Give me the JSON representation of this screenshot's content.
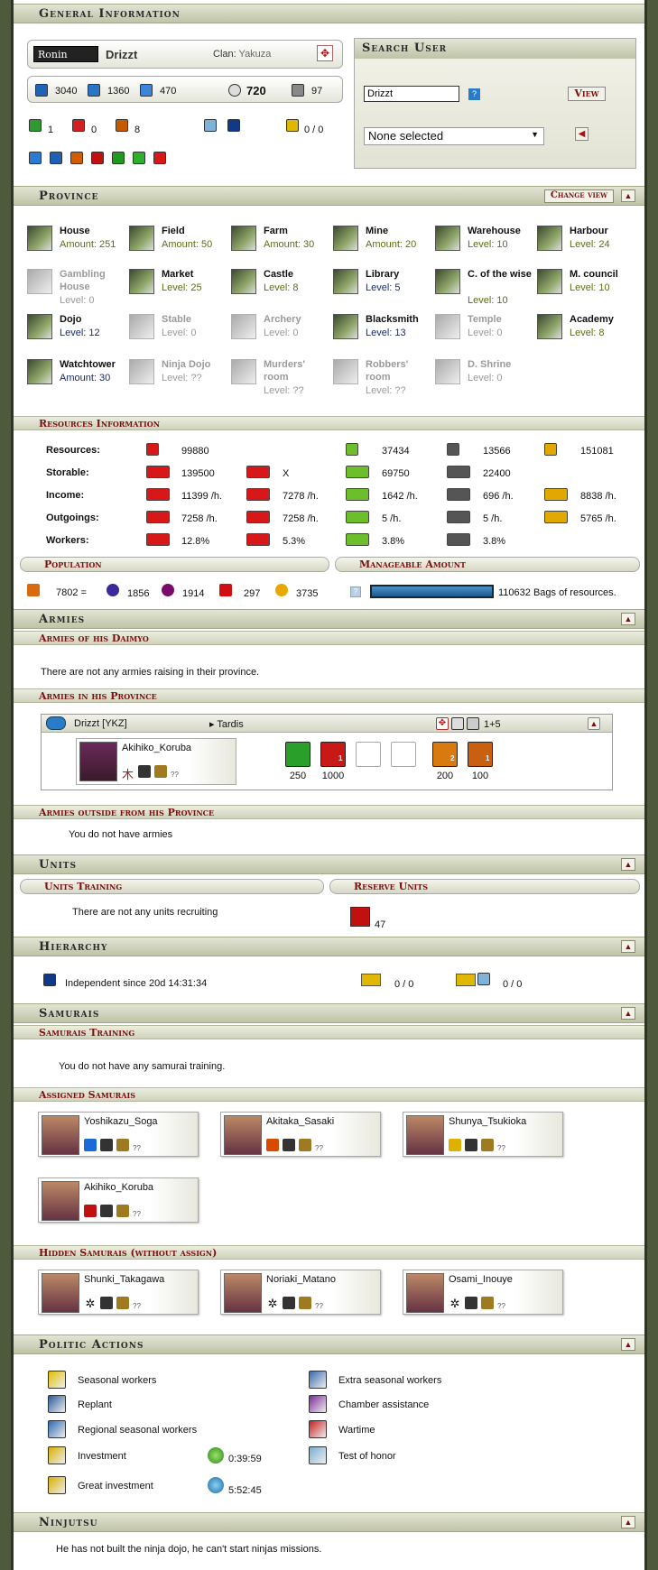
{
  "general": {
    "title": "General Information",
    "rank": "Ronin",
    "player": "Drizzt",
    "clan_label": "Clan:",
    "clan": "Yakuza",
    "stats": [
      "3040",
      "1360",
      "470",
      "720",
      "97"
    ],
    "counts": [
      "1",
      "0",
      "8",
      "0 / 0"
    ]
  },
  "search": {
    "title": "Search User",
    "value": "Drizzt",
    "select": "None selected",
    "view": "View",
    "help": "?"
  },
  "province": {
    "title": "Province",
    "change_view": "Change view",
    "buildings": [
      {
        "name": "House",
        "val": "Amount: 251",
        "s": "a"
      },
      {
        "name": "Field",
        "val": "Amount: 50",
        "s": "a"
      },
      {
        "name": "Farm",
        "val": "Amount: 30",
        "s": "a"
      },
      {
        "name": "Mine",
        "val": "Amount: 20",
        "s": "a"
      },
      {
        "name": "Warehouse",
        "val": "Level: 10",
        "s": "a"
      },
      {
        "name": "Harbour",
        "val": "Level: 24",
        "s": "a"
      },
      {
        "name": "Gambling House",
        "val": "Level: 0",
        "s": "o"
      },
      {
        "name": "Market",
        "val": "Level: 25",
        "s": "a"
      },
      {
        "name": "Castle",
        "val": "Level: 8",
        "s": "a"
      },
      {
        "name": "Library",
        "val": "Level: 5",
        "s": "b"
      },
      {
        "name": "C. of the wise",
        "val": "Level: 10",
        "s": "a"
      },
      {
        "name": "M. council",
        "val": "Level: 10",
        "s": "a"
      },
      {
        "name": "Dojo",
        "val": "Level: 12",
        "s": "b"
      },
      {
        "name": "Stable",
        "val": "Level: 0",
        "s": "o"
      },
      {
        "name": "Archery",
        "val": "Level: 0",
        "s": "o"
      },
      {
        "name": "Blacksmith",
        "val": "Level: 13",
        "s": "b"
      },
      {
        "name": "Temple",
        "val": "Level: 0",
        "s": "o"
      },
      {
        "name": "Academy",
        "val": "Level: 8",
        "s": "a"
      },
      {
        "name": "Watchtower",
        "val": "Amount: 30",
        "s": "b"
      },
      {
        "name": "Ninja Dojo",
        "val": "Level: ??",
        "s": "o"
      },
      {
        "name": "Murders' room",
        "val": "Level: ??",
        "s": "o"
      },
      {
        "name": "Robbers' room",
        "val": "Level: ??",
        "s": "o"
      },
      {
        "name": "D. Shrine",
        "val": "Level: 0",
        "s": "o"
      }
    ]
  },
  "resources": {
    "title": "Resources Information",
    "rows": [
      {
        "label": "Resources:",
        "c": [
          "99880",
          "",
          "37434",
          "13566",
          "151081"
        ]
      },
      {
        "label": "Storable:",
        "c": [
          "139500",
          "X",
          "69750",
          "22400",
          ""
        ]
      },
      {
        "label": "Income:",
        "c": [
          "11399 /h.",
          "7278 /h.",
          "1642 /h.",
          "696 /h.",
          "8838 /h."
        ]
      },
      {
        "label": "Outgoings:",
        "c": [
          "7258 /h.",
          "7258 /h.",
          "5 /h.",
          "5 /h.",
          "5765 /h."
        ]
      },
      {
        "label": "Workers:",
        "c": [
          "12.8%",
          "5.3%",
          "3.8%",
          "3.8%",
          ""
        ]
      }
    ]
  },
  "population": {
    "title": "Population",
    "total": "7802 =",
    "parts": [
      "1856",
      "1914",
      "297",
      "3735"
    ]
  },
  "manageable": {
    "title": "Manageable Amount",
    "value": "110632",
    "suffix": "Bags of resources.",
    "fill": 1.0
  },
  "armies": {
    "title": "Armies",
    "daimyo_title": "Armies of his Daimyo",
    "daimyo_text": "There are not any armies raising in their province.",
    "province_title": "Armies in his Province",
    "owner": "Drizzt [YKZ]",
    "dest": "▸ Tardis",
    "extra": "1+5",
    "general": "Akihiko_Koruba",
    "general_q": "??",
    "troops": [
      "250",
      "1000",
      "",
      "",
      "200",
      "100"
    ],
    "troop_badges": [
      "",
      "1",
      "",
      "",
      "2",
      "1"
    ],
    "outside_title": "Armies outside from his Province",
    "outside_text": "You do not have armies"
  },
  "units": {
    "title": "Units",
    "training": "Units Training",
    "reserve": "Reserve Units",
    "training_text": "There are not any units recruiting",
    "reserve_count": "47"
  },
  "hierarchy": {
    "title": "Hierarchy",
    "text": "Independent since 20d  14:31:34",
    "a": "0 / 0",
    "b": "0 / 0"
  },
  "samurais": {
    "title": "Samurais",
    "training_title": "Samurais Training",
    "training_text": "You do not have any samurai training.",
    "assigned_title": "Assigned Samurais",
    "hidden_title": "Hidden Samurais (without assign)",
    "assigned": [
      "Yoshikazu_Soga",
      "Akitaka_Sasaki",
      "Shunya_Tsukioka",
      "Akihiko_Koruba"
    ],
    "hidden": [
      "Shunki_Takagawa",
      "Noriaki_Matano",
      "Osami_Inouye"
    ],
    "q": "??"
  },
  "politics": {
    "title": "Politic Actions",
    "left": [
      "Seasonal workers",
      "Replant",
      "Regional seasonal workers",
      "Investment",
      "Great investment"
    ],
    "right": [
      "Extra seasonal workers",
      "Chamber assistance",
      "Wartime",
      "Test of honor"
    ],
    "timer1": "0:39:59",
    "timer2": "5:52:45"
  },
  "ninjutsu": {
    "title": "Ninjutsu",
    "text": "He has not built the ninja dojo, he can't start ninjas missions."
  },
  "colors": {
    "frame": "#2d3422",
    "header": "#bfc3a6",
    "accent": "#7a1010",
    "green": "#5e6e12",
    "blue": "#1a2c6a"
  }
}
